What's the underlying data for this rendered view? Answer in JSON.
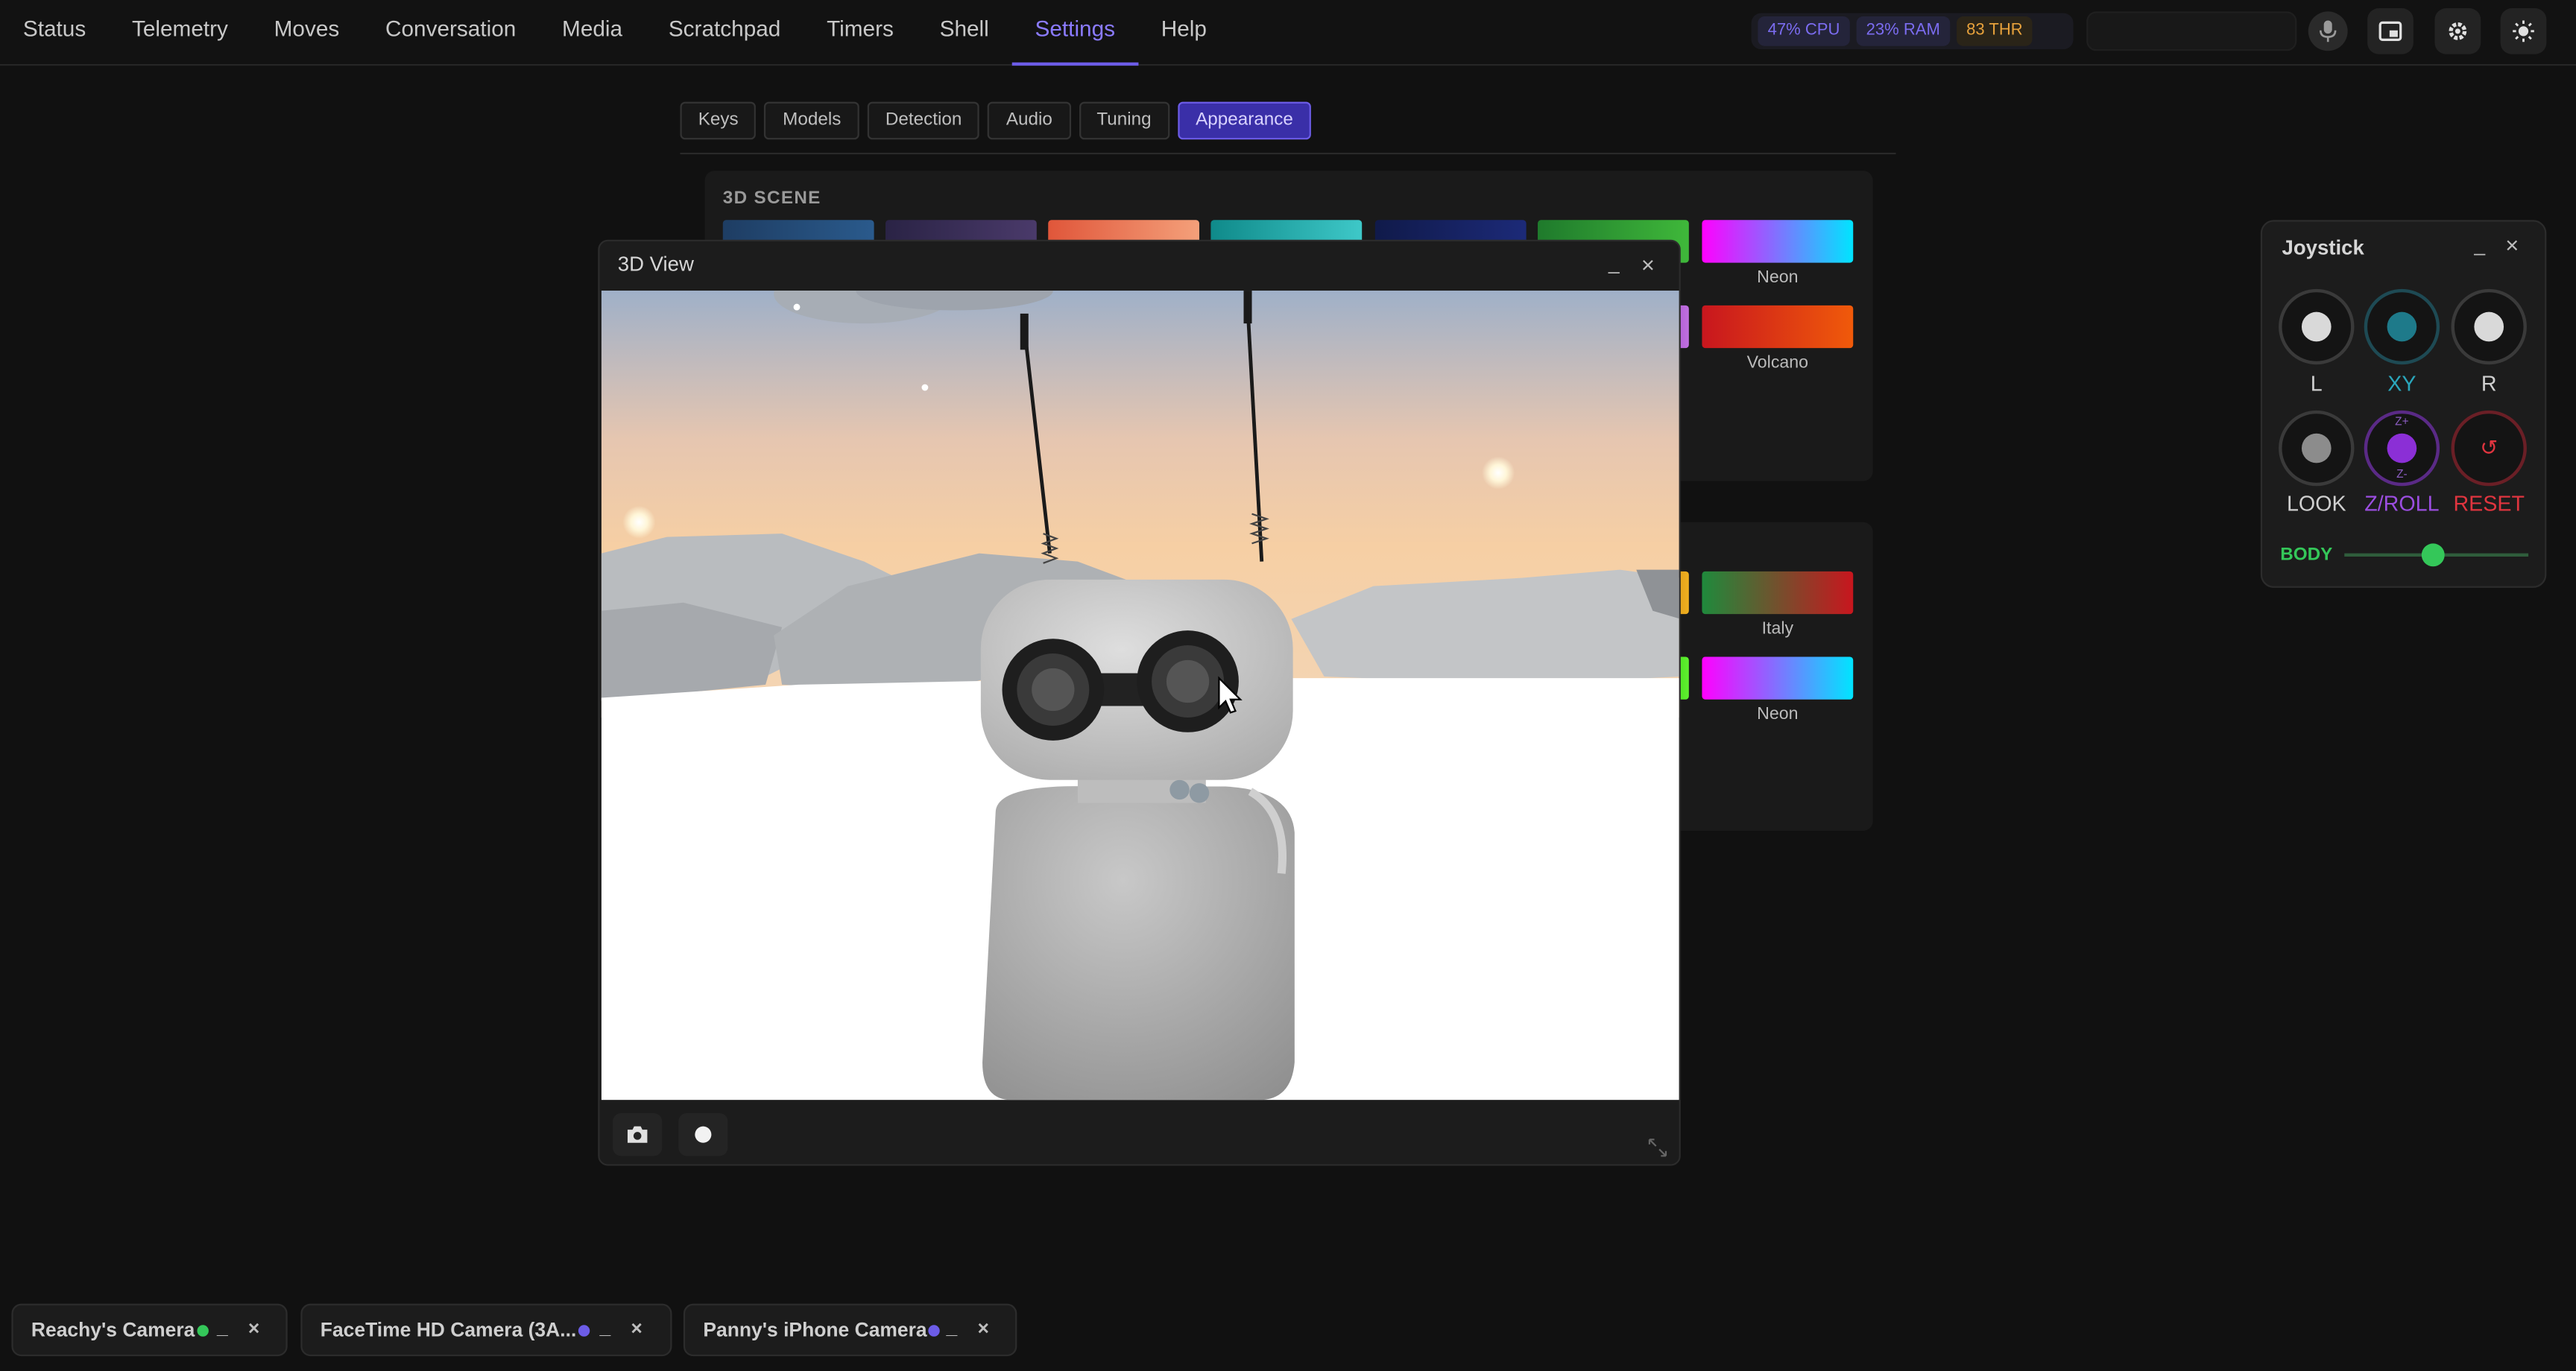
{
  "nav": {
    "items": [
      "Status",
      "Telemetry",
      "Moves",
      "Conversation",
      "Media",
      "Scratchpad",
      "Timers",
      "Shell",
      "Settings",
      "Help"
    ],
    "active": "Settings"
  },
  "stats": {
    "cpu": "47% CPU",
    "ram": "23% RAM",
    "thr": "83 THR"
  },
  "top_icons": [
    "microphone-icon",
    "picture-in-picture-icon",
    "gear-icon",
    "sun-icon"
  ],
  "settings": {
    "tabs": [
      "Keys",
      "Models",
      "Detection",
      "Audio",
      "Tuning",
      "Appearance"
    ],
    "active_tab": "Appearance",
    "scene_panel_title": "3D SCENE",
    "scene_swatches_visible": [
      "Neon",
      "Volcano"
    ],
    "ui_swatches_visible": [
      "Italy",
      "Neon"
    ]
  },
  "colors": {
    "accent": "#6c5ce7",
    "neon_gradient": [
      "#ff00ff",
      "#00e5ff"
    ],
    "volcano_gradient": [
      "#c8161e",
      "#f05a0a"
    ],
    "italy_gradient": [
      "#1f8a3c",
      "#c8161e"
    ],
    "joystick_xy": "#1e7a8a",
    "joystick_zroll": "#8b2fd6",
    "joystick_reset": "#e0353f",
    "body_slider": "#34c759"
  },
  "view3d": {
    "title": "3D View",
    "minimize_label": "_",
    "close_label": "×",
    "footer_icons": [
      "camera-icon",
      "record-icon"
    ]
  },
  "joystick": {
    "title": "Joystick",
    "minimize_label": "_",
    "close_label": "×",
    "labels": {
      "l": "L",
      "xy": "XY",
      "r": "R",
      "look": "LOOK",
      "zroll": "Z/ROLL",
      "reset": "RESET"
    },
    "zroll_top": "Z+",
    "zroll_bottom": "Z-",
    "reset_icon": "↺",
    "body_label": "BODY",
    "body_value": 0.5
  },
  "cameras": [
    {
      "name": "Reachy's Camera",
      "status_color": "#34c759"
    },
    {
      "name": "FaceTime HD Camera (3A...",
      "status_color": "#6c5ce7"
    },
    {
      "name": "Panny's iPhone Camera",
      "status_color": "#6c5ce7"
    }
  ],
  "camera_tab_controls": {
    "minimize": "_",
    "close": "×"
  }
}
